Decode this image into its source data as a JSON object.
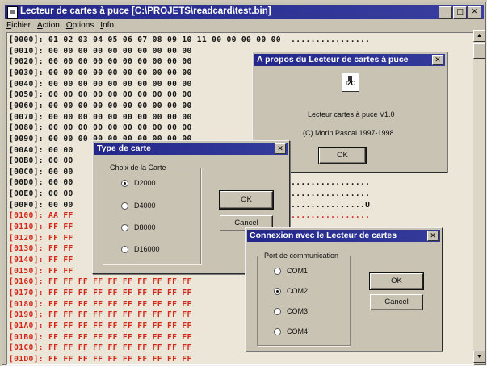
{
  "window": {
    "title": "Lecteur de cartes à puce [C:\\PROJETS\\readcard\\test.bin]",
    "minimize": "_",
    "maximize": "□",
    "close": "✕"
  },
  "menu": [
    "Fichier",
    "Action",
    "Options",
    "Info"
  ],
  "hex_rows": [
    "[0000]: 01 02 03 04 05 06 07 08 09 10 11 00 00 00 00 00  ................",
    "[0010]: 00 00 00 00 00 00 00 00 00 00",
    "[0020]: 00 00 00 00 00 00 00 00 00 00",
    "[0030]: 00 00 00 00 00 00 00 00 00 00",
    "[0040]: 00 00 00 00 00 00 00 00 00 00",
    "[0050]: 00 00 00 00 00 00 00 00 00 00",
    "[0060]: 00 00 00 00 00 00 00 00 00 00",
    "[0070]: 00 00 00 00 00 00 00 00 00 00",
    "[0080]: 00 00 00 00 00 00 00 00 00 00",
    "[0090]: 00 00 00 00 00 00 00 00 00 00",
    "[00A0]: 00 00",
    "[00B0]: 00 00",
    "[00C0]: 00 00",
    "[00D0]: 00 00                                  00 00 00  ................",
    "[00E0]: 00 00                                  00 00 00  ................",
    "[00F0]: 00 00                                  00 00 55  ...............U",
    "[0100]: AA FF                                  FF FF FF  ................",
    "[0110]: FF FF",
    "[0120]: FF FF",
    "[0130]: FF FF",
    "[0140]: FF FF",
    "[0150]: FF FF",
    "[0160]: FF FF FF FF FF FF FF FF FF FF",
    "[0170]: FF FF FF FF FF FF FF FF FF FF",
    "[0180]: FF FF FF FF FF FF FF FF FF FF",
    "[0190]: FF FF FF FF FF FF FF FF FF FF",
    "[01A0]: FF FF FF FF FF FF FF FF FF FF",
    "[01B0]: FF FF FF FF FF FF FF FF FF FF",
    "[01C0]: FF FF FF FF FF FF FF FF FF FF",
    "[01D0]: FF FF FF FF FF FF FF FF FF FF"
  ],
  "about_dialog": {
    "title": "A propos du Lecteur de cartes à puce",
    "icon_label": "I2C",
    "product": "Lecteur cartes à puce  V1.0",
    "copyright": "(C) Morin Pascal 1997-1998",
    "ok": "OK",
    "close": "✕"
  },
  "card_dialog": {
    "title": "Type de carte",
    "group": "Choix de la Carte",
    "options": [
      "D2000",
      "D4000",
      "D8000",
      "D16000"
    ],
    "selected": "D2000",
    "ok": "OK",
    "cancel": "Cancel",
    "close": "✕"
  },
  "port_dialog": {
    "title": "Connexion avec le Lecteur de cartes",
    "group": "Port de communication",
    "options": [
      "COM1",
      "COM2",
      "COM3",
      "COM4"
    ],
    "selected": "COM2",
    "ok": "OK",
    "cancel": "Cancel",
    "close": "✕"
  },
  "colors": {
    "titlebar": "#23278a",
    "red_text": "#d3281a",
    "hex_text": "#151515"
  }
}
